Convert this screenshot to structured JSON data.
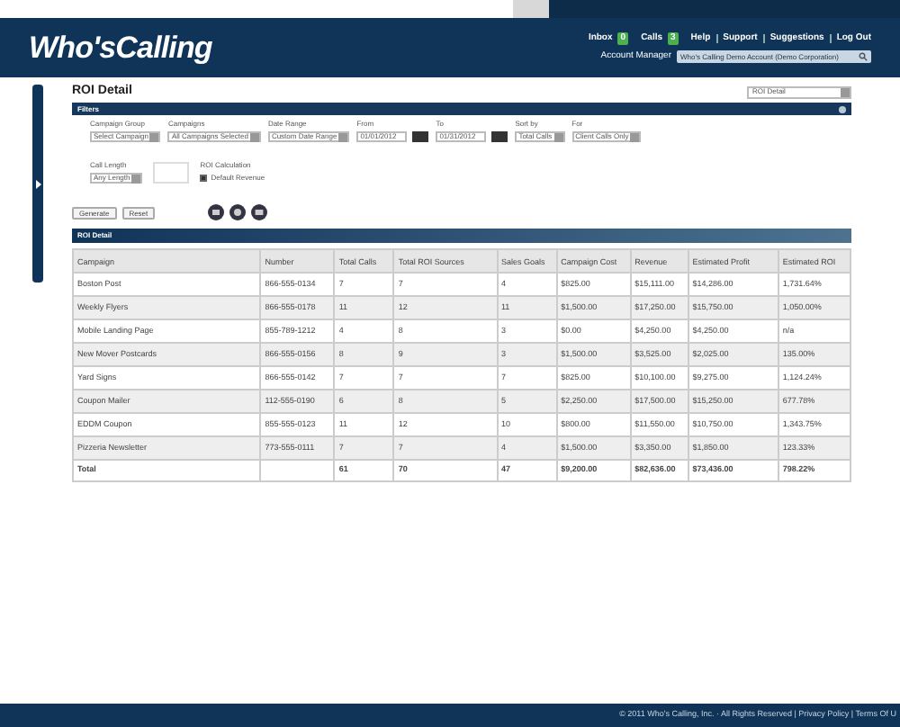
{
  "header": {
    "logo": "Who'sCalling",
    "inbox": {
      "label": "Inbox",
      "count": "0"
    },
    "calls": {
      "label": "Calls",
      "count": "3"
    },
    "links": [
      "Help",
      "Support",
      "Suggestions",
      "Log Out"
    ],
    "account_label": "Account Manager",
    "account_value": "Who's Calling Demo Account (Demo Corporation)"
  },
  "page": {
    "title": "ROI Detail",
    "report_select": "ROI Detail"
  },
  "filters": {
    "title": "Filters",
    "fields": [
      {
        "kind": "select",
        "label": "Campaign Group",
        "value": "Select Campaign"
      },
      {
        "kind": "select",
        "label": "Campaigns",
        "value": "All Campaigns Selected"
      },
      {
        "kind": "select",
        "label": "Date Range",
        "value": "Custom Date Range"
      },
      {
        "kind": "date",
        "label": "From",
        "value": "01/01/2012"
      },
      {
        "kind": "date",
        "label": "To",
        "value": "01/31/2012"
      },
      {
        "kind": "select",
        "label": "Sort by",
        "value": "Total Calls"
      },
      {
        "kind": "select",
        "label": "For",
        "value": "Client Calls Only"
      }
    ],
    "row2": [
      {
        "kind": "select",
        "label": "Call Length",
        "value": "Any Length"
      },
      {
        "kind": "blank"
      },
      {
        "kind": "check",
        "label": "ROI Calculation",
        "value": "Default Revenue",
        "checked": true
      }
    ],
    "buttons": [
      "Generate",
      "Reset"
    ]
  },
  "table": {
    "title": "ROI Detail",
    "columns": [
      "Campaign",
      "Number",
      "Total Calls",
      "Total ROI Sources",
      "Sales Goals",
      "Campaign Cost",
      "Revenue",
      "Estimated Profit",
      "Estimated ROI"
    ],
    "rows": [
      [
        "Boston Post",
        "866-555-0134",
        "7",
        "7",
        "4",
        "$825.00",
        "$15,111.00",
        "$14,286.00",
        "1,731.64%"
      ],
      [
        "Weekly Flyers",
        "866-555-0178",
        "11",
        "12",
        "11",
        "$1,500.00",
        "$17,250.00",
        "$15,750.00",
        "1,050.00%"
      ],
      [
        "Mobile Landing Page",
        "855-789-1212",
        "4",
        "8",
        "3",
        "$0.00",
        "$4,250.00",
        "$4,250.00",
        "n/a"
      ],
      [
        "New Mover Postcards",
        "866-555-0156",
        "8",
        "9",
        "3",
        "$1,500.00",
        "$3,525.00",
        "$2,025.00",
        "135.00%"
      ],
      [
        "Yard Signs",
        "866-555-0142",
        "7",
        "7",
        "7",
        "$825.00",
        "$10,100.00",
        "$9,275.00",
        "1,124.24%"
      ],
      [
        "Coupon Mailer",
        "112-555-0190",
        "6",
        "8",
        "5",
        "$2,250.00",
        "$17,500.00",
        "$15,250.00",
        "677.78%"
      ],
      [
        "EDDM Coupon",
        "855-555-0123",
        "11",
        "12",
        "10",
        "$800.00",
        "$11,550.00",
        "$10,750.00",
        "1,343.75%"
      ],
      [
        "Pizzeria Newsletter",
        "773-555-0111",
        "7",
        "7",
        "4",
        "$1,500.00",
        "$3,350.00",
        "$1,850.00",
        "123.33%"
      ]
    ],
    "total": [
      "Total",
      "61",
      "70",
      "47",
      "$9,200.00",
      "$82,636.00",
      "$73,436.00",
      "798.22%"
    ]
  },
  "footer": {
    "text": "© 2011 Who's Calling, Inc. · All Rights Reserved | Privacy Policy | Terms Of U"
  }
}
